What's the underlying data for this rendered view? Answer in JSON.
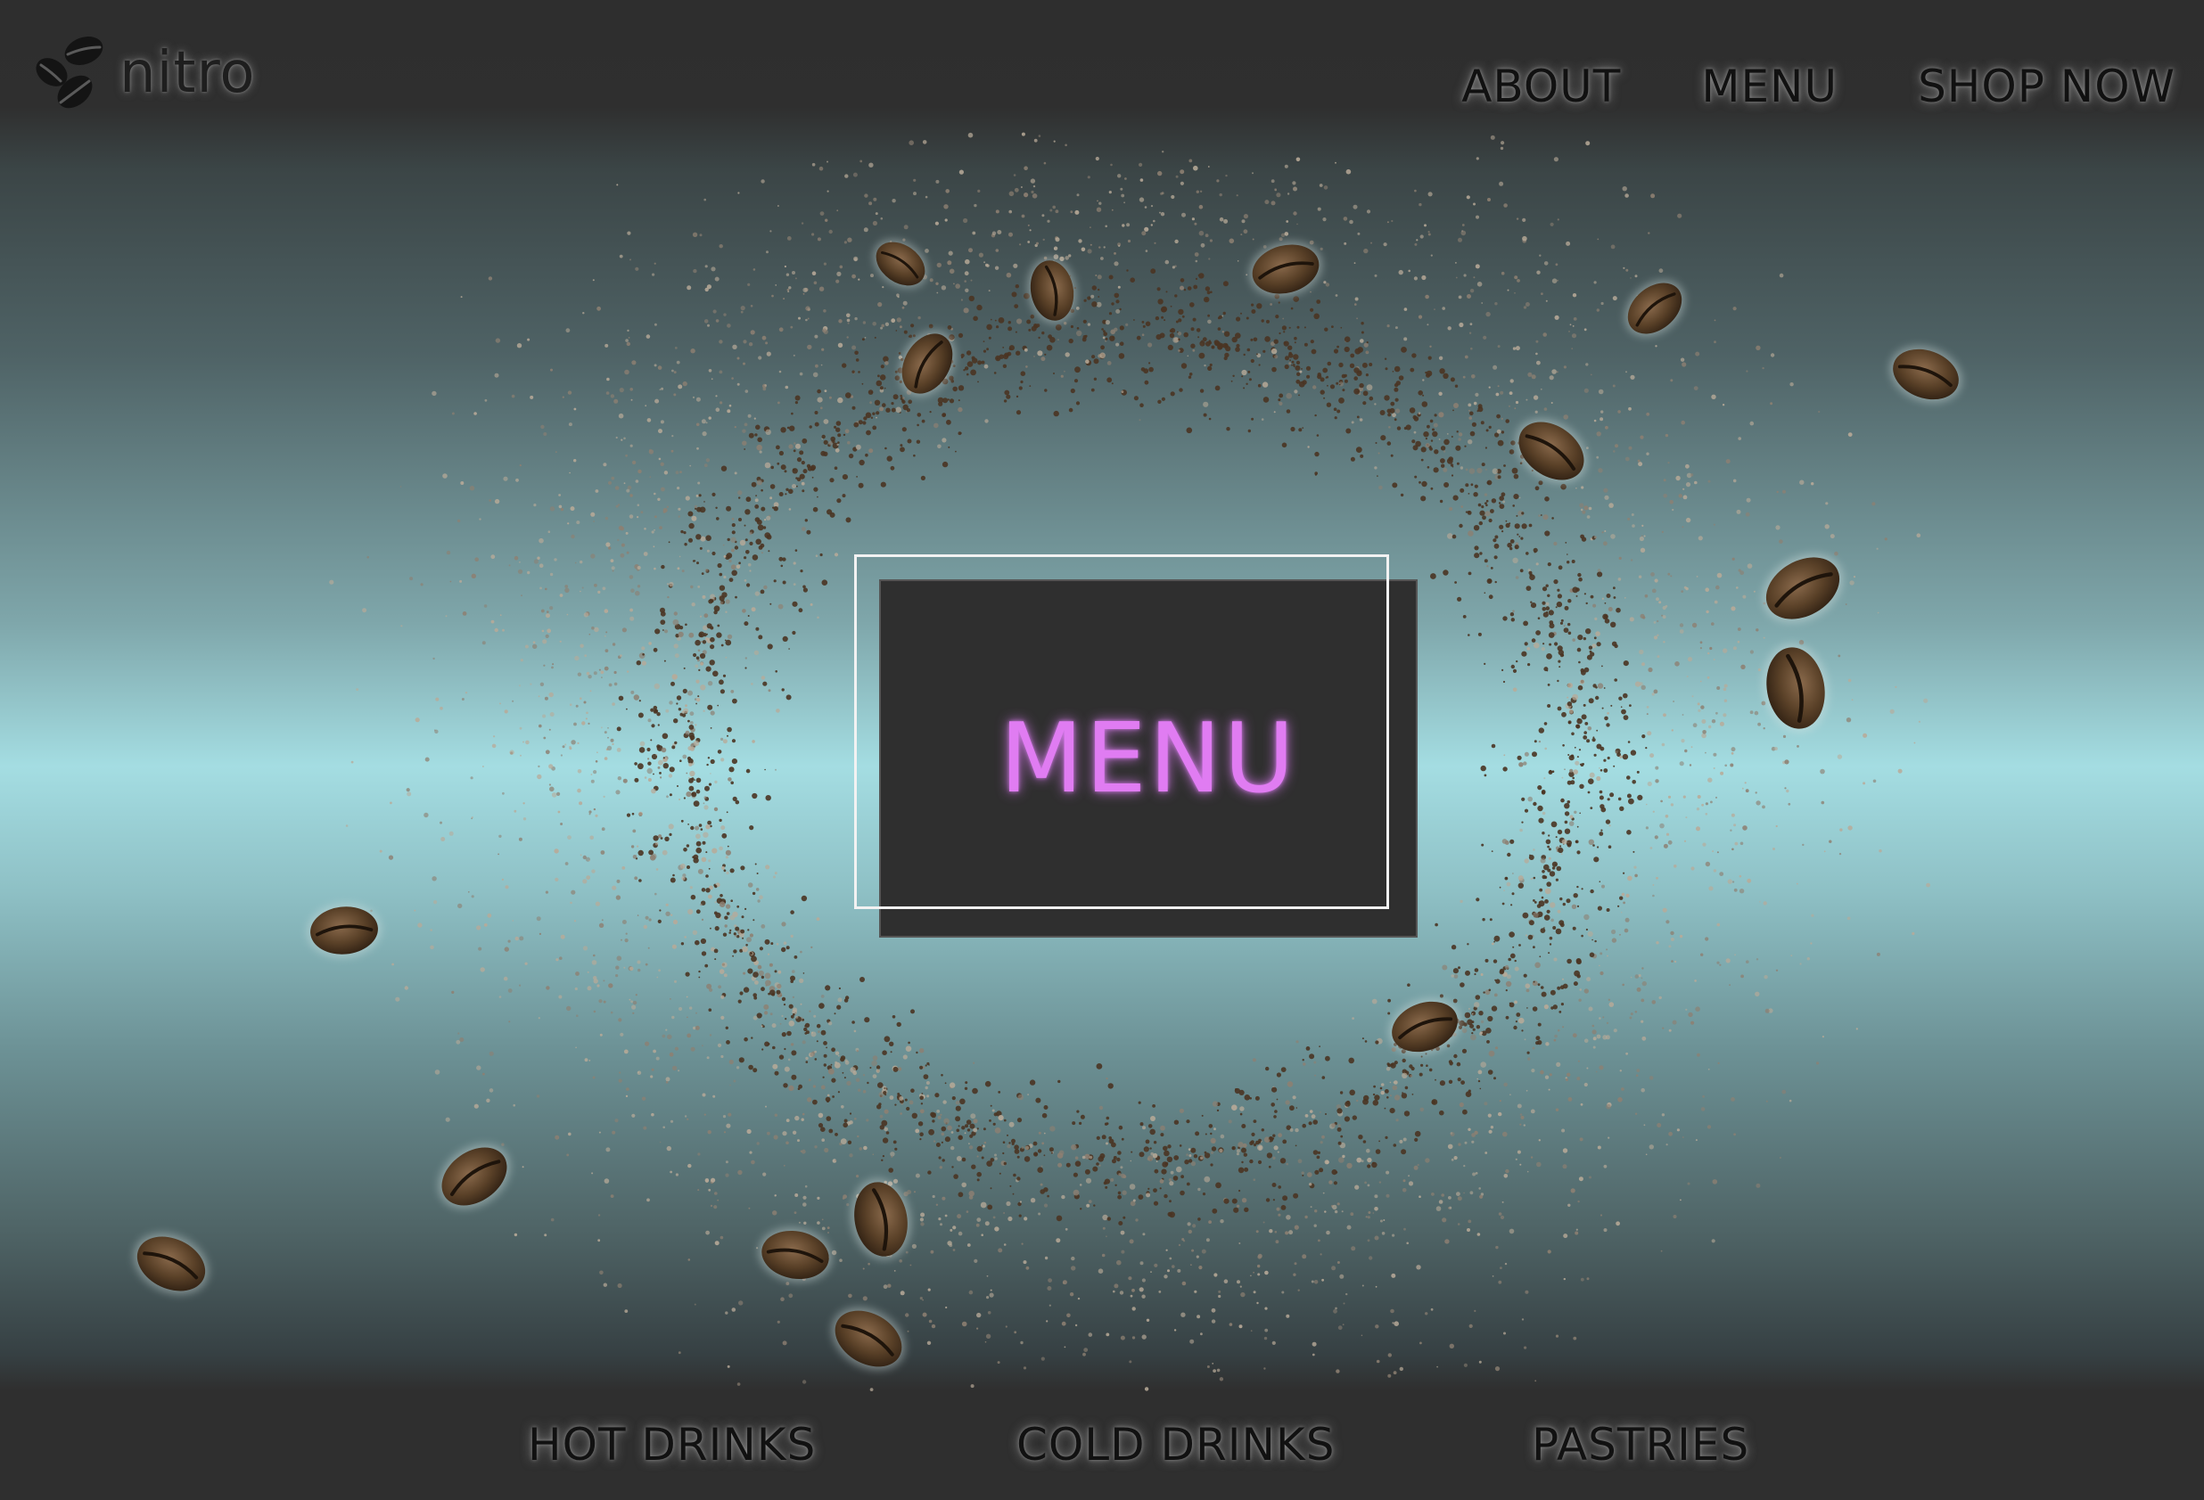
{
  "brand": {
    "name": "nitro",
    "logo_icon": "coffee-beans-icon"
  },
  "nav": {
    "items": [
      {
        "label": "ABOUT"
      },
      {
        "label": "MENU"
      },
      {
        "label": "SHOP NOW"
      }
    ]
  },
  "hero": {
    "background_art": "coffee-grounds-ring",
    "card_title": "MENU"
  },
  "categories": {
    "items": [
      {
        "label": "HOT DRINKS"
      },
      {
        "label": "COLD DRINKS"
      },
      {
        "label": "PASTRIES"
      }
    ]
  },
  "colors": {
    "bar": "#2f2f2f",
    "accent": "#e07cf2",
    "sky": "#a4dde2",
    "card_outline": "#f2f2f2"
  }
}
